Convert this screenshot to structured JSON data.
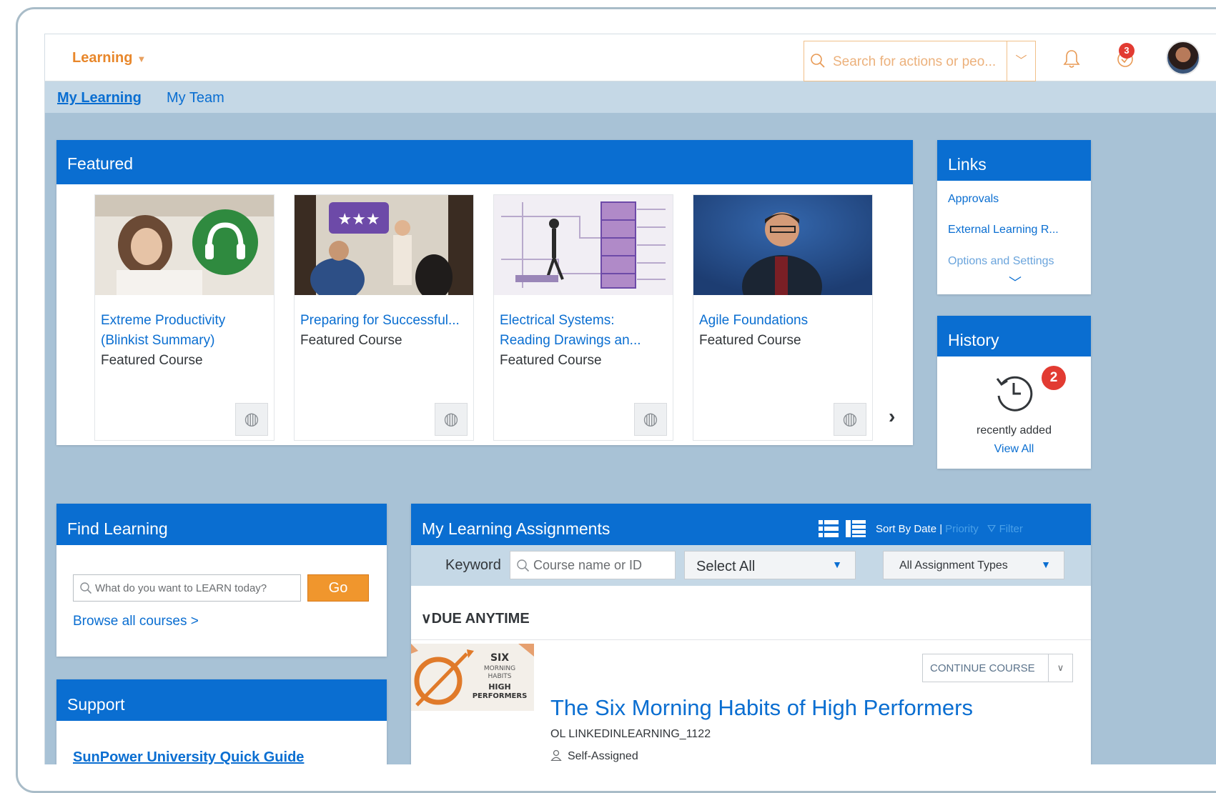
{
  "shellbar": {
    "app_title": "Learning",
    "search_placeholder": "Search for actions or peo...",
    "notification_count": "3"
  },
  "subnav": {
    "tabs": [
      {
        "label": "My Learning",
        "active": true
      },
      {
        "label": "My Team",
        "active": false
      }
    ]
  },
  "featured": {
    "title": "Featured",
    "items": [
      {
        "title": "Extreme Productivity (Blinkist Summary)",
        "subtitle": "Featured Course"
      },
      {
        "title": "Preparing for Successful...",
        "subtitle": "Featured Course"
      },
      {
        "title": "Electrical Systems: Reading Drawings an...",
        "subtitle": "Featured Course"
      },
      {
        "title": "Agile Foundations",
        "subtitle": "Featured Course"
      }
    ]
  },
  "links": {
    "title": "Links",
    "items": [
      "Approvals",
      "External Learning R...",
      "Options and Settings"
    ]
  },
  "history": {
    "title": "History",
    "count": "2",
    "text": "recently added",
    "view_all": "View All"
  },
  "find": {
    "title": "Find Learning",
    "placeholder": "What do you want to LEARN today?",
    "go": "Go",
    "browse": "Browse all courses >"
  },
  "support": {
    "title": "Support",
    "guide": "SunPower University Quick Guide"
  },
  "assignments": {
    "title": "My Learning Assignments",
    "sort_by": "Sort By Date |",
    "priority": "Priority",
    "filter": "Filter",
    "keyword_label": "Keyword",
    "keyword_placeholder": "Course name or ID",
    "select_all": "Select All",
    "assignment_types": "All Assignment Types",
    "group": "DUE ANYTIME",
    "course": {
      "thumb_text": [
        "SIX",
        "MORNING",
        "HABITS",
        "HIGH",
        "PERFORMERS"
      ],
      "button": "CONTINUE COURSE",
      "title": "The Six Morning Habits of High Performers",
      "code": "OL LINKEDINLEARNING_1122",
      "assigned": "Self-Assigned"
    }
  },
  "colors": {
    "brand_blue": "#0a6ed1",
    "accent_orange": "#e8872b",
    "background": "#a8c2d6",
    "badge_red": "#e23b32"
  }
}
